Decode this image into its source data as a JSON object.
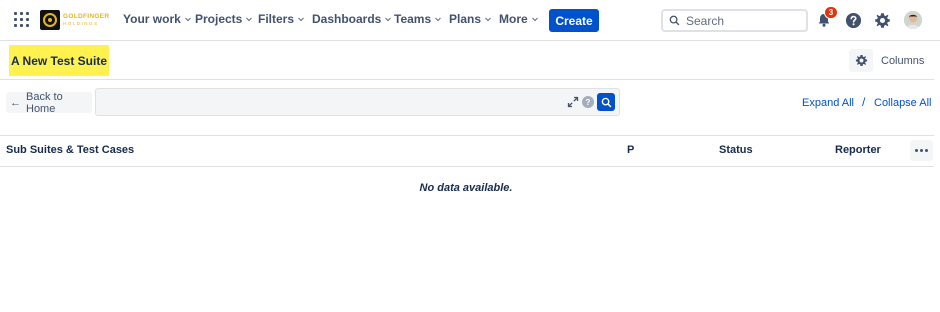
{
  "brand": {
    "logo_text_line1": "GOLDFINGER",
    "logo_text_line2": "HOLDINGS",
    "accent_color": "#e5b520"
  },
  "topnav": {
    "items": [
      {
        "label": "Your work",
        "icon": "chevron-down-icon"
      },
      {
        "label": "Projects",
        "icon": "chevron-down-icon"
      },
      {
        "label": "Filters",
        "icon": "chevron-down-icon"
      },
      {
        "label": "Dashboards",
        "icon": "chevron-down-icon"
      },
      {
        "label": "Teams",
        "icon": "chevron-down-icon"
      },
      {
        "label": "Plans",
        "icon": "chevron-down-icon"
      },
      {
        "label": "More",
        "icon": "chevron-down-icon"
      }
    ],
    "create_label": "Create",
    "create_color": "#0052cc",
    "search_placeholder": "Search",
    "notification_count": "3",
    "icons": [
      "app-switcher-icon",
      "search-icon",
      "bell-icon",
      "help-icon",
      "gear-icon",
      "avatar"
    ]
  },
  "header": {
    "suite_title": "A New Test Suite",
    "suite_title_bg": "#fff250",
    "columns_label": "Columns"
  },
  "toolbar": {
    "back_label": "Back to Home",
    "filter_value": "",
    "expand_all": "Expand All",
    "separator": "/",
    "collapse_all": "Collapse All"
  },
  "table": {
    "columns": [
      "Sub Suites & Test Cases",
      "P",
      "Status",
      "Reporter"
    ],
    "empty_message": "No data available."
  }
}
